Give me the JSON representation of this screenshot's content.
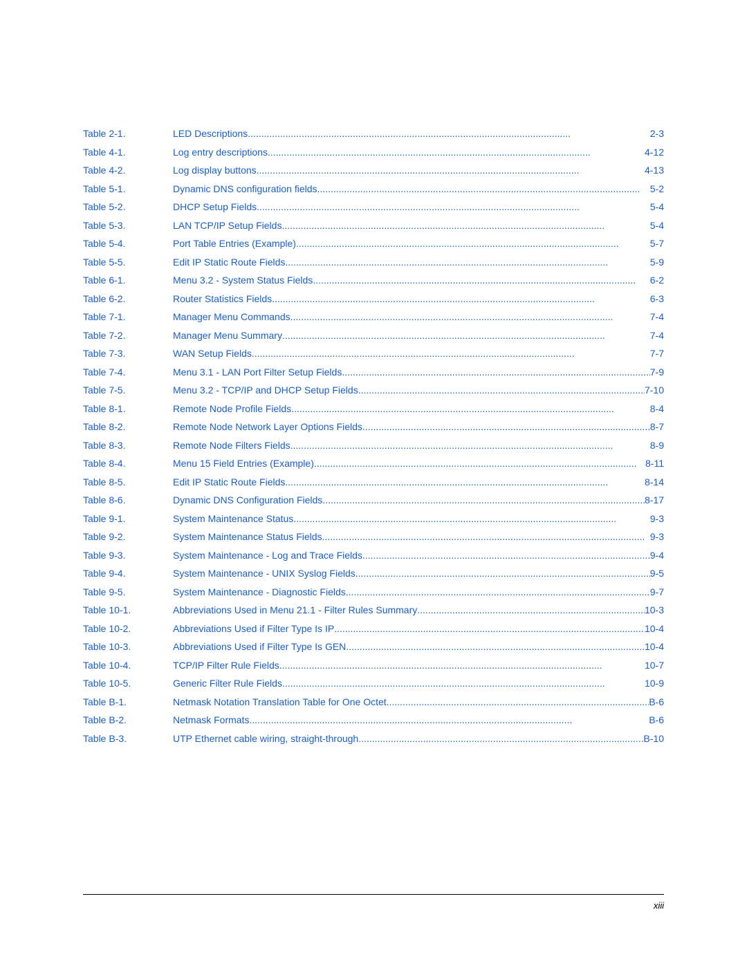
{
  "footer": {
    "page": "xiii"
  },
  "entries": [
    {
      "label": "Table 2-1.",
      "title": "LED Descriptions",
      "dots": true,
      "page": "2-3"
    },
    {
      "label": "Table 4-1.",
      "title": "Log entry descriptions",
      "dots": true,
      "page": "4-12"
    },
    {
      "label": "Table 4-2.",
      "title": "Log display buttons",
      "dots": true,
      "page": "4-13"
    },
    {
      "label": "Table 5-1.",
      "title": "Dynamic DNS configuration fields",
      "dots": true,
      "page": "5-2"
    },
    {
      "label": "Table 5-2.",
      "title": "DHCP Setup Fields",
      "dots": true,
      "page": "5-4"
    },
    {
      "label": "Table 5-3.",
      "title": "LAN TCP/IP Setup Fields",
      "dots": true,
      "page": "5-4"
    },
    {
      "label": "Table 5-4.",
      "title": "Port Table Entries (Example)",
      "dots": true,
      "page": "5-7"
    },
    {
      "label": "Table 5-5.",
      "title": "Edit IP Static Route Fields",
      "dots": true,
      "page": "5-9"
    },
    {
      "label": "Table 6-1.",
      "title": "Menu 3.2 - System Status Fields",
      "dots": true,
      "page": "6-2"
    },
    {
      "label": "Table 6-2.",
      "title": "Router Statistics Fields",
      "dots": true,
      "page": "6-3"
    },
    {
      "label": "Table 7-1.",
      "title": "Manager Menu Commands",
      "dots": true,
      "page": "7-4"
    },
    {
      "label": "Table 7-2.",
      "title": "Manager Menu Summary",
      "dots": true,
      "page": "7-4"
    },
    {
      "label": "Table 7-3.",
      "title": "WAN Setup Fields",
      "dots": true,
      "page": "7-7"
    },
    {
      "label": "Table 7-4.",
      "title": "Menu 3.1 - LAN Port Filter Setup Fields",
      "dots": true,
      "page": "7-9"
    },
    {
      "label": "Table 7-5.",
      "title": "Menu 3.2 - TCP/IP and DHCP Setup Fields",
      "dots": true,
      "page": "7-10"
    },
    {
      "label": "Table 8-1.",
      "title": "Remote Node Profile Fields",
      "dots": true,
      "page": "8-4"
    },
    {
      "label": "Table 8-2.",
      "title": "Remote Node Network Layer Options Fields",
      "dots": true,
      "page": "8-7"
    },
    {
      "label": "Table 8-3.",
      "title": "Remote Node Filters Fields",
      "dots": true,
      "page": "8-9"
    },
    {
      "label": "Table 8-4.",
      "title": "Menu 15 Field Entries (Example)",
      "dots": true,
      "page": "8-11"
    },
    {
      "label": "Table 8-5.",
      "title": "Edit IP Static Route Fields",
      "dots": true,
      "page": "8-14"
    },
    {
      "label": "Table 8-6.",
      "title": "Dynamic DNS Configuration Fields",
      "dots": true,
      "page": "8-17"
    },
    {
      "label": "Table 9-1.",
      "title": "System Maintenance Status",
      "dots": true,
      "page": "9-3"
    },
    {
      "label": "Table 9-2.",
      "title": "System Maintenance Status Fields",
      "dots": true,
      "page": "9-3"
    },
    {
      "label": "Table 9-3.",
      "title": "System Maintenance - Log and Trace Fields",
      "dots": true,
      "page": "9-4"
    },
    {
      "label": "Table 9-4.",
      "title": "System Maintenance - UNIX Syslog Fields",
      "dots": true,
      "page": "9-5"
    },
    {
      "label": "Table 9-5.",
      "title": "System Maintenance - Diagnostic Fields",
      "dots": true,
      "page": "9-7"
    },
    {
      "label": "Table 10-1.",
      "title": "Abbreviations Used in Menu 21.1 - Filter Rules Summary",
      "dots": true,
      "page": "10-3"
    },
    {
      "label": "Table 10-2.",
      "title": "Abbreviations Used if Filter Type Is IP",
      "dots": true,
      "page": "10-4"
    },
    {
      "label": "Table 10-3.",
      "title": "Abbreviations Used if Filter Type Is GEN",
      "dots": true,
      "page": "10-4"
    },
    {
      "label": "Table 10-4.",
      "title": "TCP/IP Filter Rule Fields",
      "dots": true,
      "page": "10-7"
    },
    {
      "label": "Table 10-5.",
      "title": "Generic Filter Rule Fields",
      "dots": true,
      "page": "10-9"
    },
    {
      "label": "Table B-1.",
      "title": "Netmask Notation Translation Table for One Octet",
      "dots": true,
      "page": "B-6"
    },
    {
      "label": "Table B-2.",
      "title": "Netmask Formats",
      "dots": true,
      "page": "B-6"
    },
    {
      "label": "Table B-3.",
      "title": "UTP Ethernet cable wiring, straight-through",
      "dots": true,
      "page": "B-10"
    }
  ]
}
